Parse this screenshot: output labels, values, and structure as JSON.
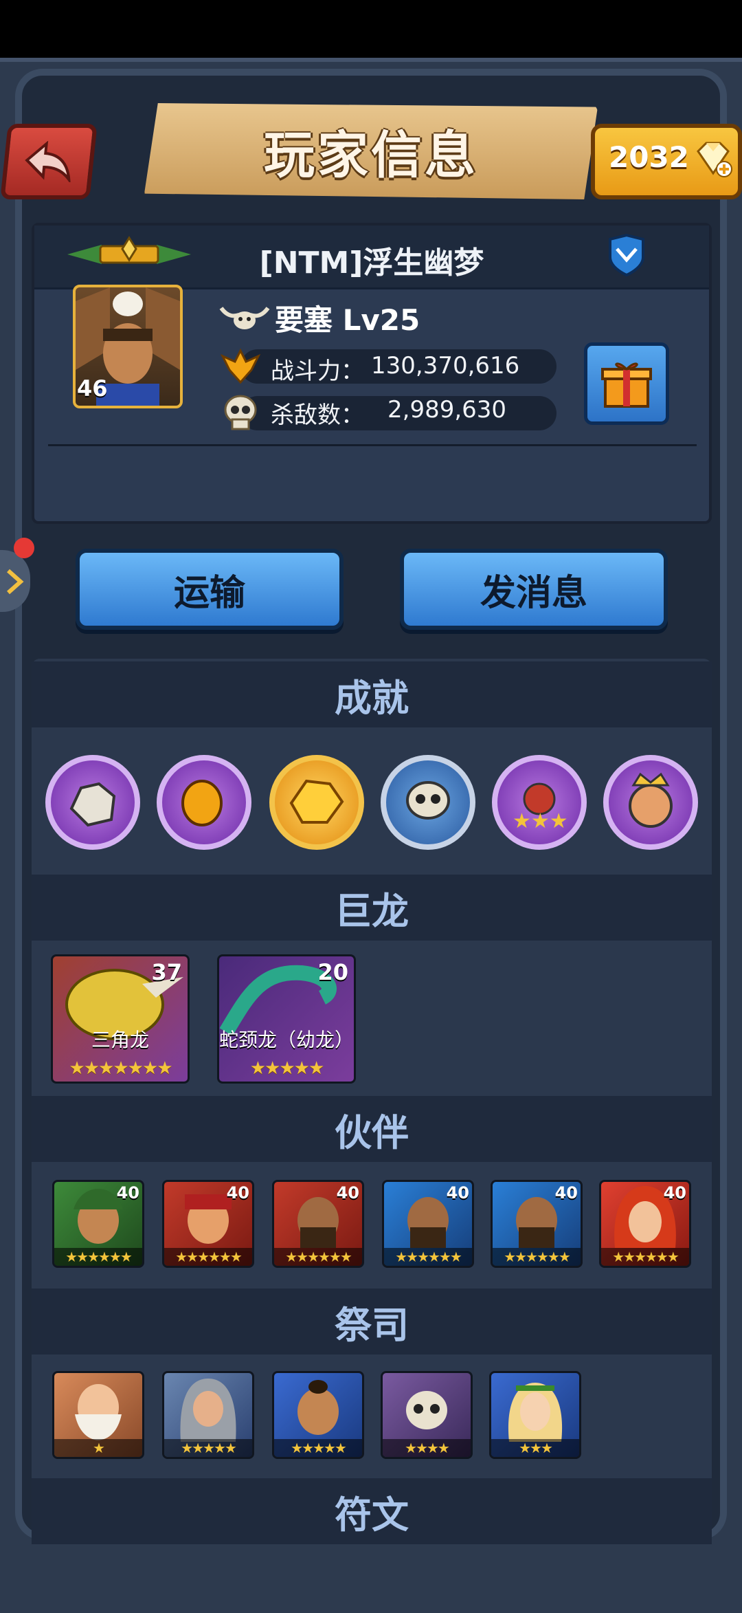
{
  "header": {
    "title": "玩家信息",
    "gems": "2032"
  },
  "player": {
    "name": "[NTM]浮生幽梦",
    "avatar_level": "46",
    "fortress": "要塞 Lv25",
    "power_label": "战斗力：",
    "power_value": "130,370,616",
    "kills_label": "杀敌数：",
    "kills_value": "2,989,630"
  },
  "actions": {
    "transport": "运输",
    "message": "发消息"
  },
  "sections": {
    "achievements": "成就",
    "dragons": "巨龙",
    "partners": "伙伴",
    "priests": "祭司",
    "runes": "符文"
  },
  "dragons": [
    {
      "name": "三角龙",
      "level": "37",
      "stars": "★★★★★★★"
    },
    {
      "name": "蛇颈龙（幼龙）",
      "level": "20",
      "stars": "★★★★★"
    }
  ],
  "partners": [
    {
      "level": "40",
      "stars": "★★★★★★"
    },
    {
      "level": "40",
      "stars": "★★★★★★"
    },
    {
      "level": "40",
      "stars": "★★★★★★"
    },
    {
      "level": "40",
      "stars": "★★★★★★"
    },
    {
      "level": "40",
      "stars": "★★★★★★"
    },
    {
      "level": "40",
      "stars": "★★★★★★"
    }
  ],
  "priests": [
    {
      "stars": "★"
    },
    {
      "stars": "★★★★★"
    },
    {
      "stars": "★★★★★"
    },
    {
      "stars": "★★★★"
    },
    {
      "stars": "★★★"
    }
  ]
}
